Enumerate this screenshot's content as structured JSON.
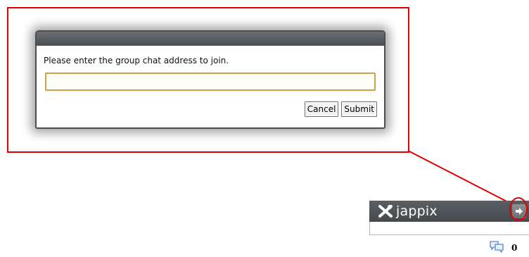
{
  "dialog": {
    "message": "Please enter the group chat address to join.",
    "input_value": "",
    "input_placeholder": "",
    "cancel_label": "Cancel",
    "submit_label": "Submit"
  },
  "jappix": {
    "brand": "jappix",
    "logo_icon": "jappix-logo-icon",
    "arrow_icon": "arrow-right-icon",
    "chat_icon": "chat-bubbles-icon",
    "chat_count": "0"
  },
  "colors": {
    "annotation": "#e00000",
    "bar": "#4a4f53",
    "input_border": "#c9a24a",
    "chat_icon": "#5b86c8"
  }
}
